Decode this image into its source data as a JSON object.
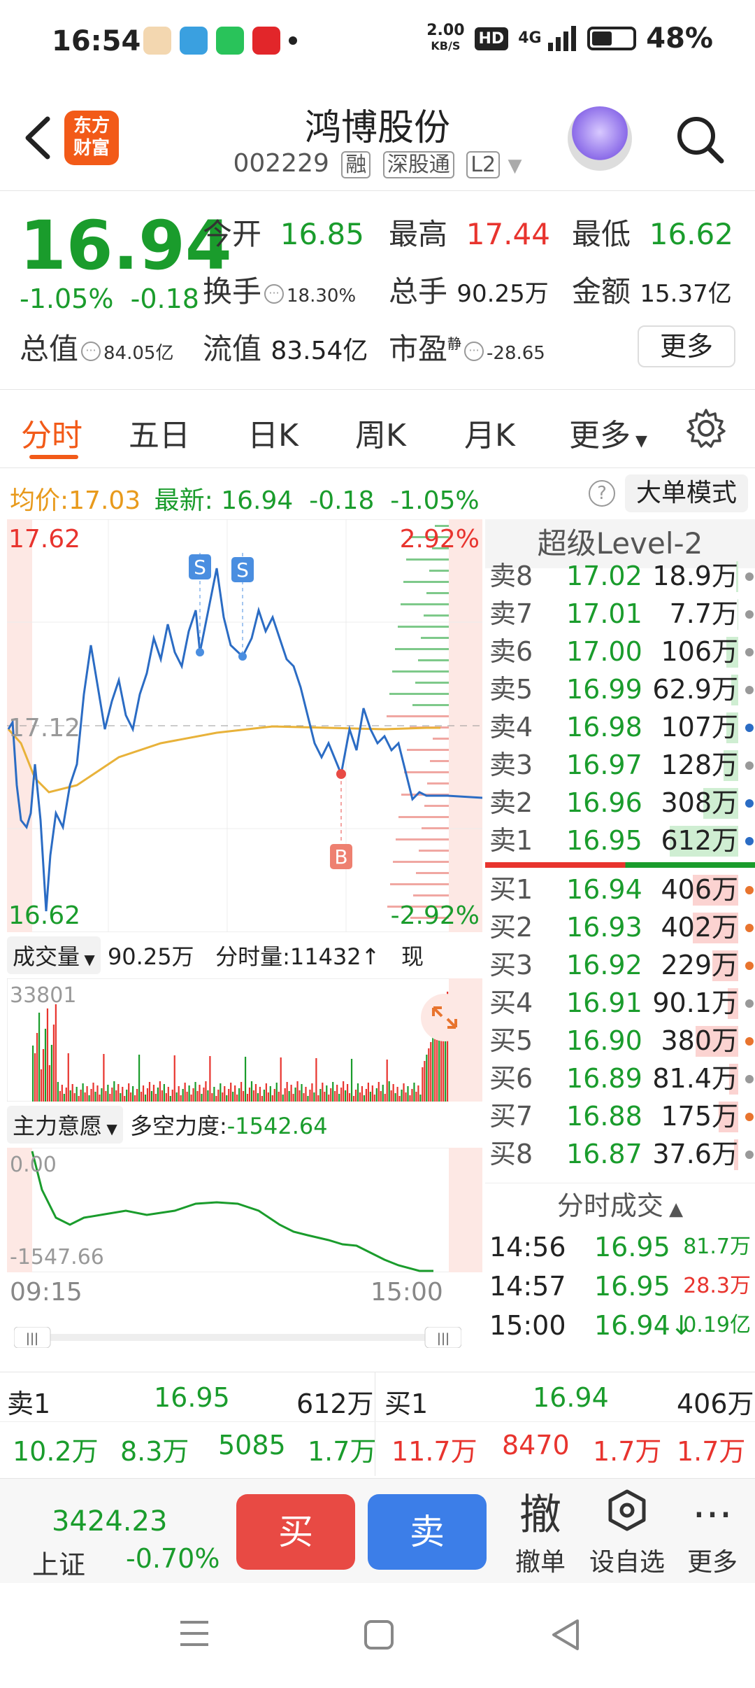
{
  "status": {
    "time": "16:54",
    "speed_value": "2.00",
    "speed_unit": "KB/S",
    "hd": "HD",
    "network": "4G",
    "battery": "48%"
  },
  "header": {
    "logo_line1": "东方",
    "logo_line2": "财富",
    "title": "鸿博股份",
    "code": "002229",
    "tags": [
      "融",
      "深股通",
      "L2"
    ]
  },
  "quote": {
    "price": "16.94",
    "pct": "-1.05%",
    "change": "-0.18",
    "open_label": "今开",
    "open": "16.85",
    "high_label": "最高",
    "high": "17.44",
    "low_label": "最低",
    "low": "16.62",
    "turnover_label": "换手",
    "turnover": "18.30%",
    "volume_label": "总手",
    "volume": "90.25万",
    "amount_label": "金额",
    "amount": "15.37亿",
    "total_mv_label": "总值",
    "total_mv": "84.05亿",
    "float_mv_label": "流值",
    "float_mv": "83.54亿",
    "pe_label": "市盈",
    "pe_sup": "静",
    "pe": "-28.65",
    "more": "更多"
  },
  "tabs": [
    "分时",
    "五日",
    "日K",
    "周K",
    "月K",
    "更多"
  ],
  "avgline": {
    "avg_label": "均价:",
    "avg": "17.03",
    "latest_label": "最新:",
    "latest": "16.94",
    "chg": "-0.18",
    "pct": "-1.05%",
    "big_mode": "大单模式"
  },
  "chart": {
    "high_label": "17.62",
    "mid_label": "17.12",
    "low_label": "16.62",
    "up_pct": "2.92%",
    "down_pct": "-2.92%",
    "s_marker": "S",
    "b_marker": "B"
  },
  "vol": {
    "label": "成交量",
    "total": "90.25万",
    "min_vol": "分时量:11432",
    "cur_vol_label": "现量:",
    "cur_vol": "11432",
    "max": "33801"
  },
  "force": {
    "label": "主力意愿",
    "name": "多空力度:",
    "value": "-1542.64",
    "top": "0.00",
    "bottom": "-1547.66"
  },
  "time_axis": {
    "start": "09:15",
    "end": "15:00"
  },
  "level2": {
    "title": "超级Level-2",
    "asks": [
      {
        "level": "卖8",
        "price": "17.02",
        "vol": "18.9万"
      },
      {
        "level": "卖7",
        "price": "17.01",
        "vol": "7.7万"
      },
      {
        "level": "卖6",
        "price": "17.00",
        "vol": "106万"
      },
      {
        "level": "卖5",
        "price": "16.99",
        "vol": "62.9万"
      },
      {
        "level": "卖4",
        "price": "16.98",
        "vol": "107万"
      },
      {
        "level": "卖3",
        "price": "16.97",
        "vol": "128万"
      },
      {
        "level": "卖2",
        "price": "16.96",
        "vol": "308万"
      },
      {
        "level": "卖1",
        "price": "16.95",
        "vol": "612万"
      }
    ],
    "bids": [
      {
        "level": "买1",
        "price": "16.94",
        "vol": "406万"
      },
      {
        "level": "买2",
        "price": "16.93",
        "vol": "402万"
      },
      {
        "level": "买3",
        "price": "16.92",
        "vol": "229万"
      },
      {
        "level": "买4",
        "price": "16.91",
        "vol": "90.1万"
      },
      {
        "level": "买5",
        "price": "16.90",
        "vol": "380万"
      },
      {
        "level": "买6",
        "price": "16.89",
        "vol": "81.4万"
      },
      {
        "level": "买7",
        "price": "16.88",
        "vol": "175万"
      },
      {
        "level": "买8",
        "price": "16.87",
        "vol": "37.6万"
      }
    ],
    "trade_title": "分时成交",
    "trades": [
      {
        "time": "14:56",
        "price": "16.95",
        "vol": "81.7万"
      },
      {
        "time": "14:57",
        "price": "16.95",
        "vol": "28.3万"
      },
      {
        "time": "15:00",
        "price": "16.94",
        "vol": "0.19亿"
      }
    ]
  },
  "strip": {
    "ask_label": "卖1",
    "ask_price": "16.95",
    "ask_vol": "612万",
    "bid_label": "买1",
    "bid_price": "16.94",
    "bid_vol": "406万",
    "ask_row": [
      "10.2万",
      "8.3万",
      "5085",
      "1.7万"
    ],
    "bid_row": [
      "11.7万",
      "8470",
      "1.7万",
      "1.7万"
    ]
  },
  "action": {
    "index_value": "3424.23",
    "index_name": "上证",
    "index_pct": "-0.70%",
    "buy": "买",
    "sell": "卖",
    "cancel_icon": "撤",
    "cancel": "撤单",
    "watch": "设自选",
    "more": "更多"
  }
}
